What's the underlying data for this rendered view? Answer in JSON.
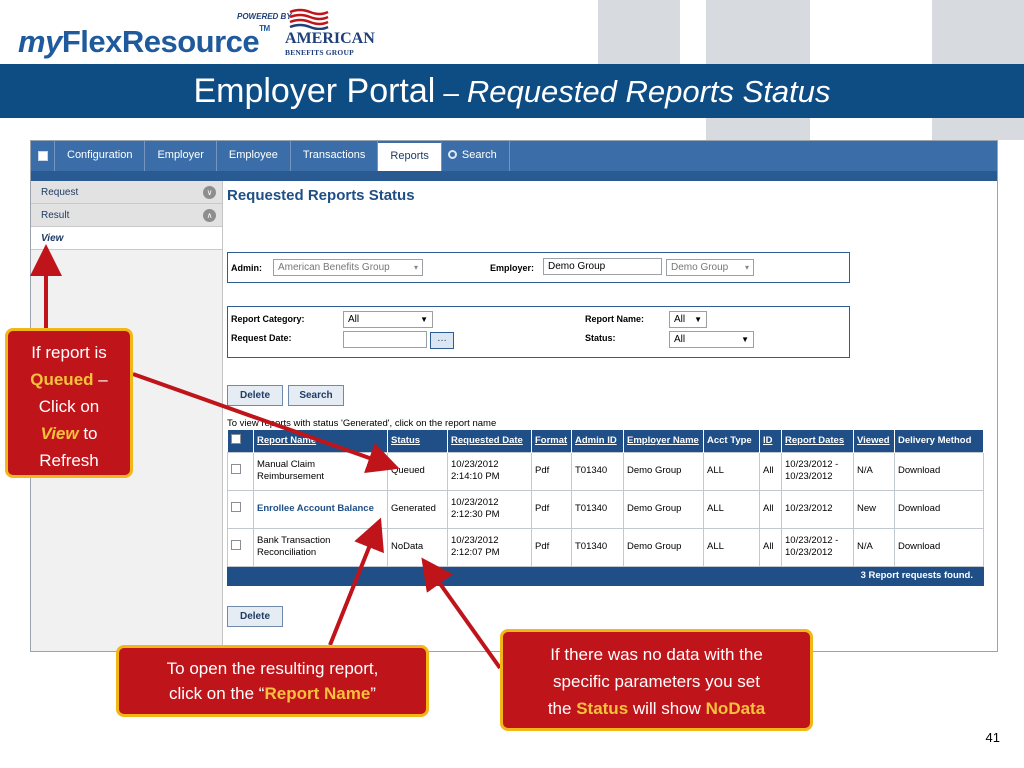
{
  "logo": {
    "my": "my",
    "flex": "FlexResource",
    "tm": "TM",
    "powered": "POWERED BY",
    "american": "AMERICAN",
    "abg": "BENEFITS GROUP"
  },
  "title": {
    "main": "Employer Portal",
    "sep": "–",
    "sub": "Requested Reports Status"
  },
  "nav": {
    "tabs": [
      "Configuration",
      "Employer",
      "Employee",
      "Transactions",
      "Reports",
      "Search"
    ],
    "active": "Reports"
  },
  "sidebar": {
    "items": [
      {
        "label": "Request"
      },
      {
        "label": "Result"
      },
      {
        "label": "View"
      }
    ]
  },
  "main": {
    "title": "Requested Reports Status",
    "admin_label": "Admin:",
    "admin_value": "American Benefits Group",
    "employer_label": "Employer:",
    "employer_input": "Demo Group",
    "employer_select": "Demo Group",
    "report_category_label": "Report Category:",
    "report_category_value": "All",
    "request_date_label": "Request Date:",
    "report_name_label": "Report Name:",
    "report_name_value": "All",
    "status_label": "Status:",
    "status_value": "All",
    "calendar_btn": "…",
    "delete_label": "Delete",
    "search_label": "Search",
    "note": "To view reports with status 'Generated', click on the report name"
  },
  "table": {
    "headers": [
      "Report Name",
      "Status",
      "Requested Date",
      "Format",
      "Admin ID",
      "Employer Name",
      "Acct Type",
      "ID",
      "Report Dates",
      "Viewed",
      "Delivery Method"
    ],
    "rows": [
      {
        "name": "Manual Claim Reimbursement",
        "status": "Queued",
        "requested": "10/23/2012 2:14:10 PM",
        "format": "Pdf",
        "admin_id": "T01340",
        "employer": "Demo Group",
        "acct_type": "ALL",
        "id": "All",
        "dates": "10/23/2012 - 10/23/2012",
        "viewed": "N/A",
        "delivery": "Download"
      },
      {
        "name": "Enrollee Account Balance",
        "status": "Generated",
        "requested": "10/23/2012 2:12:30 PM",
        "format": "Pdf",
        "admin_id": "T01340",
        "employer": "Demo Group",
        "acct_type": "ALL",
        "id": "All",
        "dates": "10/23/2012",
        "viewed": "New",
        "delivery": "Download"
      },
      {
        "name": "Bank Transaction Reconciliation",
        "status": "NoData",
        "requested": "10/23/2012 2:12:07 PM",
        "format": "Pdf",
        "admin_id": "T01340",
        "employer": "Demo Group",
        "acct_type": "ALL",
        "id": "All",
        "dates": "10/23/2012 - 10/23/2012",
        "viewed": "N/A",
        "delivery": "Download"
      }
    ],
    "footer": "3 Report requests found."
  },
  "callouts": {
    "left": {
      "l1": "If report is",
      "queued": "Queued",
      "l2": "–",
      "l3": "Click on",
      "view": "View",
      "l4": "to",
      "l5": "Refresh"
    },
    "bottom": {
      "l1": "To open the resulting report,",
      "l2": "click on the “",
      "bold": "Report Name",
      "l3": "”"
    },
    "right": {
      "l1": "If there was no data with the",
      "l2": "specific parameters you set",
      "l3": "the",
      "status": "Status",
      "l4": "will show",
      "nodata": "NoData"
    }
  },
  "page_number": "41",
  "colors": {
    "accent": "#0e4c84",
    "callout": "#c0141b",
    "callout_border": "#f2b619",
    "arrow": "#c0141b"
  }
}
